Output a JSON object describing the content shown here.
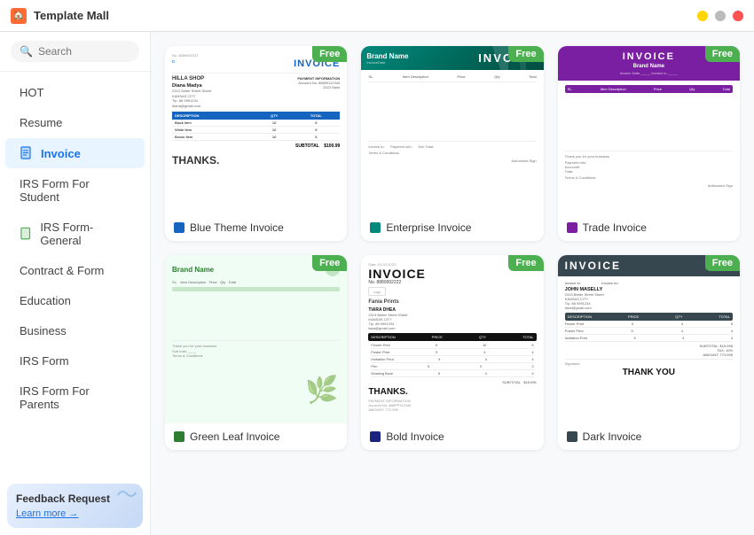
{
  "app": {
    "title": "Template Mall"
  },
  "titlebar": {
    "min_label": "–",
    "max_label": "□",
    "close_label": "×"
  },
  "search": {
    "placeholder": "Search"
  },
  "sidebar": {
    "items": [
      {
        "id": "hot",
        "label": "HOT",
        "icon": "🔥",
        "active": false
      },
      {
        "id": "resume",
        "label": "Resume",
        "icon": "",
        "active": false
      },
      {
        "id": "invoice",
        "label": "Invoice",
        "icon": "📄",
        "active": true
      },
      {
        "id": "irs-form-student",
        "label": "IRS Form For Student",
        "icon": "",
        "active": false
      },
      {
        "id": "irs-form-general",
        "label": "IRS Form-General",
        "icon": "📋",
        "active": false
      },
      {
        "id": "contract-form",
        "label": "Contract & Form",
        "icon": "",
        "active": false
      },
      {
        "id": "education",
        "label": "Education",
        "icon": "",
        "active": false
      },
      {
        "id": "business",
        "label": "Business",
        "icon": "",
        "active": false
      },
      {
        "id": "irs-form",
        "label": "IRS Form",
        "icon": "",
        "active": false
      },
      {
        "id": "irs-form-parents",
        "label": "IRS Form For Parents",
        "icon": "",
        "active": false
      }
    ]
  },
  "feedback": {
    "title": "Feedback Request",
    "link_text": "Learn more →"
  },
  "templates": [
    {
      "id": "blue-theme-invoice",
      "name": "Blue Theme Invoice",
      "badge": "Free",
      "type_color": "#1565c0"
    },
    {
      "id": "enterprise-invoice",
      "name": "Enterprise Invoice",
      "badge": "Free",
      "type_color": "#00897b"
    },
    {
      "id": "trade-invoice",
      "name": "Trade Invoice",
      "badge": "Free",
      "type_color": "#7b1fa2"
    },
    {
      "id": "green-leaf-invoice",
      "name": "Green Leaf Invoice",
      "badge": "Free",
      "type_color": "#2e7d32"
    },
    {
      "id": "bold-invoice",
      "name": "Bold Invoice",
      "badge": "Free",
      "type_color": "#1a237e"
    },
    {
      "id": "dark-invoice",
      "name": "Dark Invoice",
      "badge": "Free",
      "type_color": "#37474f"
    }
  ],
  "invoice_data": {
    "blue": {
      "phone": "No. 8889992222",
      "shop": "HILLA SHOP",
      "name": "Diana Madya",
      "address": "2313 Setter Street Sheet, KANSAS CITY, Tlp. 88 9991234, diana@gmail.com",
      "payment_title": "PAYMENT INFORMATION",
      "account": "Account No. 88899112345, 2022 Bank",
      "col1": "DESCRIPTION",
      "col2": "QTY",
      "col3": "TOTAL",
      "rows": [
        {
          "item": "Black Item",
          "qty": "10",
          "total": "5"
        },
        {
          "item": "White Item",
          "qty": "10",
          "total": "5"
        },
        {
          "item": "Brown Item",
          "qty": "10",
          "total": "5"
        }
      ],
      "subtotal": "$100.99",
      "thanks": "THANKS."
    },
    "enterprise": {
      "brand": "Brand Name",
      "title": "INVOICE",
      "date_label": "InvoiceDate",
      "terms": "Terms & Conditions"
    },
    "trade": {
      "title": "INVOICE",
      "brand": "Brand Name",
      "invoice_to_label": "Invoice to:",
      "terms": "Terms & Conditions"
    }
  }
}
